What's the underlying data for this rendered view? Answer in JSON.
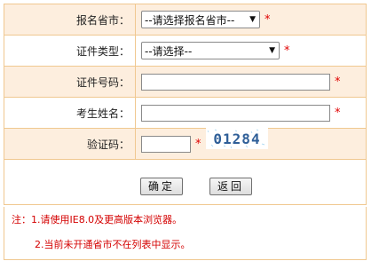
{
  "form": {
    "province": {
      "label": "报名省市：",
      "selected": "--请选择报名省市--"
    },
    "idtype": {
      "label": "证件类型：",
      "selected": "--请选择--"
    },
    "idnumber": {
      "label": "证件号码：",
      "value": ""
    },
    "name": {
      "label": "考生姓名：",
      "value": ""
    },
    "captcha": {
      "label": "验证码：",
      "value": "",
      "image_text": "01284"
    },
    "required_mark": "*"
  },
  "buttons": {
    "confirm": "确定",
    "back": "返回"
  },
  "notes": {
    "line1": "注：1.请使用IE8.0及更高版本浏览器。",
    "line2": "2.当前未开通省市不在列表中显示。"
  },
  "colors": {
    "border": "#f0c890",
    "tint": "#fdeede",
    "required": "#e00000",
    "note": "#d40000"
  }
}
